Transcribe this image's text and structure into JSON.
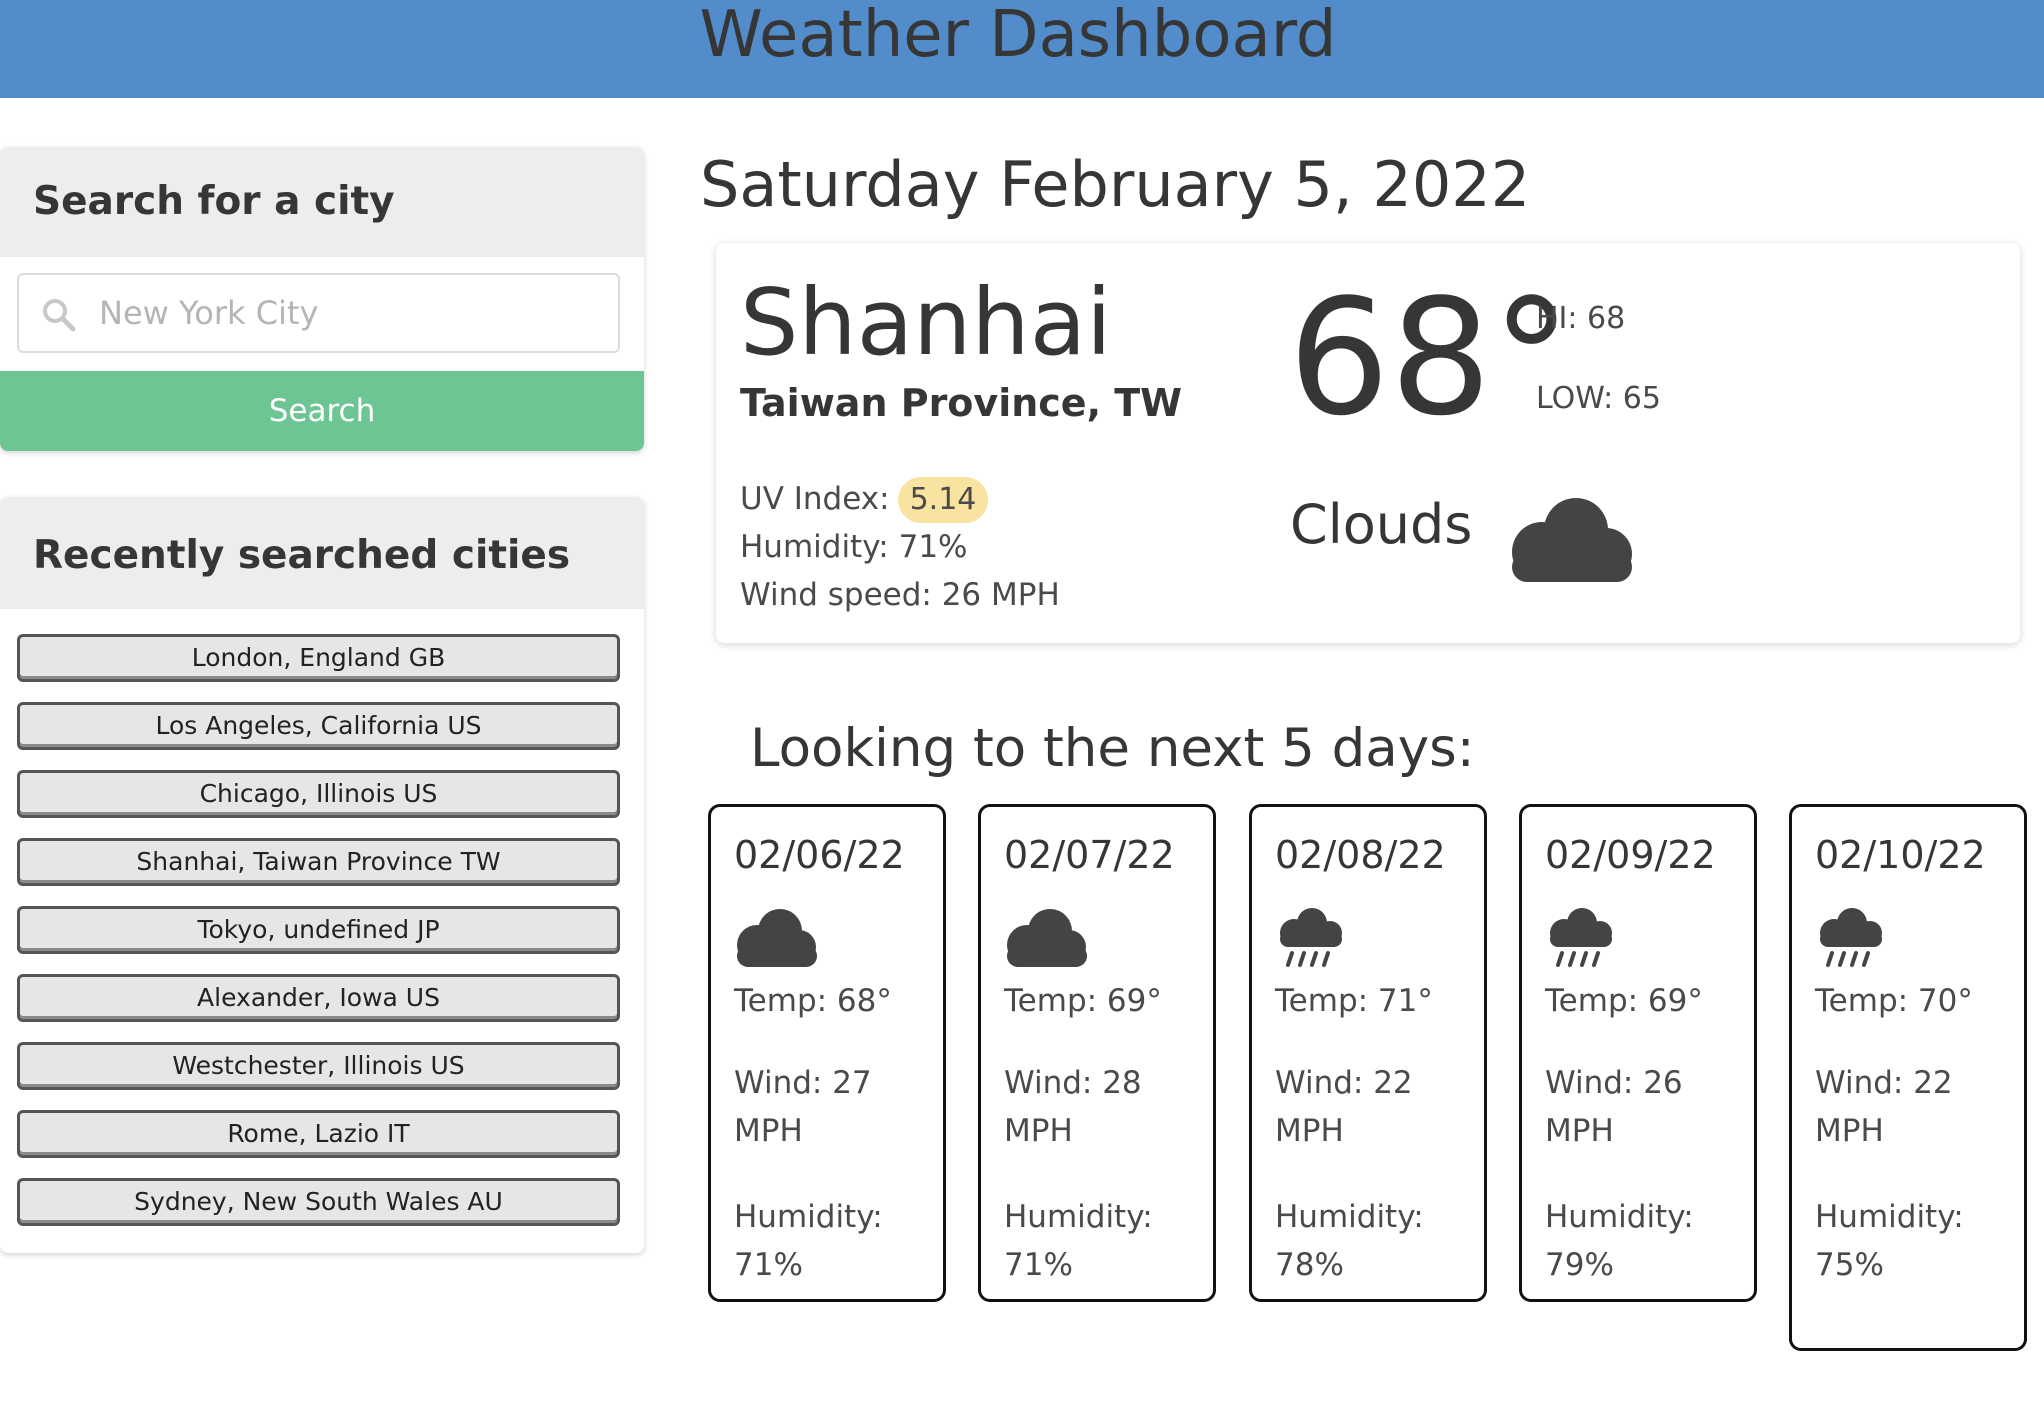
{
  "header": {
    "title": "Weather Dashboard"
  },
  "search": {
    "heading": "Search for a city",
    "placeholder": "New York City",
    "button_label": "Search",
    "icon": "search-icon"
  },
  "recent": {
    "heading": "Recently searched cities",
    "cities": [
      "London, England GB",
      "Los Angeles, California US",
      "Chicago, Illinois US",
      "Shanhai, Taiwan Province TW",
      "Tokyo, undefined JP",
      "Alexander, Iowa US",
      "Westchester, Illinois US",
      "Rome, Lazio IT",
      "Sydney, New South Wales AU"
    ]
  },
  "current": {
    "date": "Saturday February 5, 2022",
    "city": "Shanhai",
    "region": "Taiwan Province, TW",
    "uv_label": "UV Index:",
    "uv_value": "5.14",
    "humidity": "Humidity: 71%",
    "wind": "Wind speed: 26 MPH",
    "temp": "68°",
    "hi": "HI: 68",
    "low": "LOW: 65",
    "condition": "Clouds",
    "icon": "cloud-icon",
    "uv_badge_color": "#f8e4a0"
  },
  "forecast": {
    "title": "Looking to the next 5 days:",
    "days": [
      {
        "date": "02/06/22",
        "icon": "cloud-icon",
        "temp": "Temp: 68°",
        "wind": "Wind: 27 MPH",
        "humidity": "Humidity: 71%"
      },
      {
        "date": "02/07/22",
        "icon": "cloud-icon",
        "temp": "Temp: 69°",
        "wind": "Wind: 28 MPH",
        "humidity": "Humidity: 71%"
      },
      {
        "date": "02/08/22",
        "icon": "rain-icon",
        "temp": "Temp: 71°",
        "wind": "Wind: 22 MPH",
        "humidity": "Humidity: 78%"
      },
      {
        "date": "02/09/22",
        "icon": "rain-icon",
        "temp": "Temp: 69°",
        "wind": "Wind: 26 MPH",
        "humidity": "Humidity: 79%"
      },
      {
        "date": "02/10/22",
        "icon": "rain-icon",
        "temp": "Temp: 70°",
        "wind": "Wind: 22 MPH",
        "humidity": "Humidity: 75%"
      }
    ]
  },
  "colors": {
    "header_bg": "#528ccb",
    "search_button": "#6dc594",
    "panel_head_bg": "#ededed",
    "icon": "#444444"
  }
}
